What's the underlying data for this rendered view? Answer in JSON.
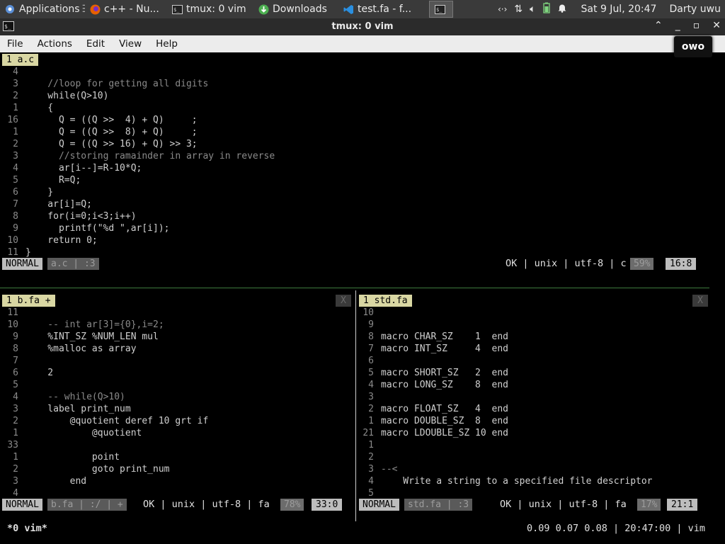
{
  "panel": {
    "apps_label": "Applications",
    "tasks": [
      {
        "label": "c++ - Nu..."
      },
      {
        "label": "tmux: 0 vim"
      },
      {
        "label": "Downloads"
      },
      {
        "label": "test.fa - f..."
      }
    ],
    "clock": "Sat  9 Jul, 20:47",
    "user": "Darty uwu"
  },
  "window": {
    "title": "tmux: 0 vim"
  },
  "menu": {
    "file": "File",
    "actions": "Actions",
    "edit": "Edit",
    "view": "View",
    "help": "Help"
  },
  "tooltip": "owo",
  "top_pane": {
    "tab": "1 a.c",
    "lines": [
      {
        "n": "4",
        "t": ""
      },
      {
        "n": "3",
        "t": "    //loop for getting all digits"
      },
      {
        "n": "2",
        "t": "    while(Q>10)"
      },
      {
        "n": "1",
        "t": "    {"
      },
      {
        "n": "16",
        "t": "      Q = ((Q >>  4) + Q)     ;"
      },
      {
        "n": "1",
        "t": "      Q = ((Q >>  8) + Q)     ;"
      },
      {
        "n": "2",
        "t": "      Q = ((Q >> 16) + Q) >> 3;"
      },
      {
        "n": "3",
        "t": "      //storing ramainder in array in reverse"
      },
      {
        "n": "4",
        "t": "      ar[i--]=R-10*Q;"
      },
      {
        "n": "5",
        "t": "      R=Q;"
      },
      {
        "n": "6",
        "t": "    }"
      },
      {
        "n": "7",
        "t": "    ar[i]=Q;"
      },
      {
        "n": "8",
        "t": "    for(i=0;i<3;i++)"
      },
      {
        "n": "9",
        "t": "      printf(\"%d \",ar[i]);"
      },
      {
        "n": "10",
        "t": "    return 0;"
      },
      {
        "n": "11",
        "t": "}"
      }
    ],
    "status": {
      "mode": "NORMAL",
      "file": "a.c",
      "sep": ":3",
      "right": "OK | unix | utf-8 | c",
      "pct": "59%",
      "pos": "16:8"
    }
  },
  "left_pane": {
    "tab": "1 b.fa +",
    "close": "X",
    "lines": [
      {
        "n": "11",
        "t": ""
      },
      {
        "n": "10",
        "t": "    -- int ar[3]={0},i=2;"
      },
      {
        "n": "9",
        "t": "    %INT_SZ %NUM_LEN mul"
      },
      {
        "n": "8",
        "t": "    %malloc as array"
      },
      {
        "n": "7",
        "t": ""
      },
      {
        "n": "6",
        "t": "    2"
      },
      {
        "n": "5",
        "t": ""
      },
      {
        "n": "4",
        "t": "    -- while(Q>10)"
      },
      {
        "n": "3",
        "t": "    label print_num"
      },
      {
        "n": "2",
        "t": "        @quotient deref 10 grt if"
      },
      {
        "n": "1",
        "t": "            @quotient"
      },
      {
        "n": "33",
        "t": ""
      },
      {
        "n": "1",
        "t": "            point"
      },
      {
        "n": "2",
        "t": "            goto print_num"
      },
      {
        "n": "3",
        "t": "        end"
      },
      {
        "n": "4",
        "t": ""
      }
    ],
    "status": {
      "mode": "NORMAL",
      "file": "b.fa | :/ | +",
      "right": "OK | unix | utf-8 | fa",
      "pct": "78%",
      "pos": "33:0"
    }
  },
  "right_pane": {
    "tab": "1 std.fa",
    "close": "X",
    "lines": [
      {
        "n": "10",
        "t": ""
      },
      {
        "n": "9",
        "t": ""
      },
      {
        "n": "8",
        "t": "macro CHAR_SZ    1  end"
      },
      {
        "n": "7",
        "t": "macro INT_SZ     4  end"
      },
      {
        "n": "6",
        "t": ""
      },
      {
        "n": "5",
        "t": "macro SHORT_SZ   2  end"
      },
      {
        "n": "4",
        "t": "macro LONG_SZ    8  end"
      },
      {
        "n": "3",
        "t": ""
      },
      {
        "n": "2",
        "t": "macro FLOAT_SZ   4  end"
      },
      {
        "n": "1",
        "t": "macro DOUBLE_SZ  8  end"
      },
      {
        "n": "21",
        "t": "macro LDOUBLE_SZ 10 end"
      },
      {
        "n": "1",
        "t": ""
      },
      {
        "n": "2",
        "t": ""
      },
      {
        "n": "3",
        "t": "--<"
      },
      {
        "n": "4",
        "t": "    Write a string to a specified file descriptor"
      },
      {
        "n": "5",
        "t": ""
      }
    ],
    "status": {
      "mode": "NORMAL",
      "file": "std.fa | :3",
      "right": "OK | unix | utf-8 | fa",
      "pct": "17%",
      "pos": "21:1"
    }
  },
  "tmux": {
    "left": "*0 vim*",
    "right": "0.09 0.07 0.08 | 20:47:00 | vim"
  }
}
